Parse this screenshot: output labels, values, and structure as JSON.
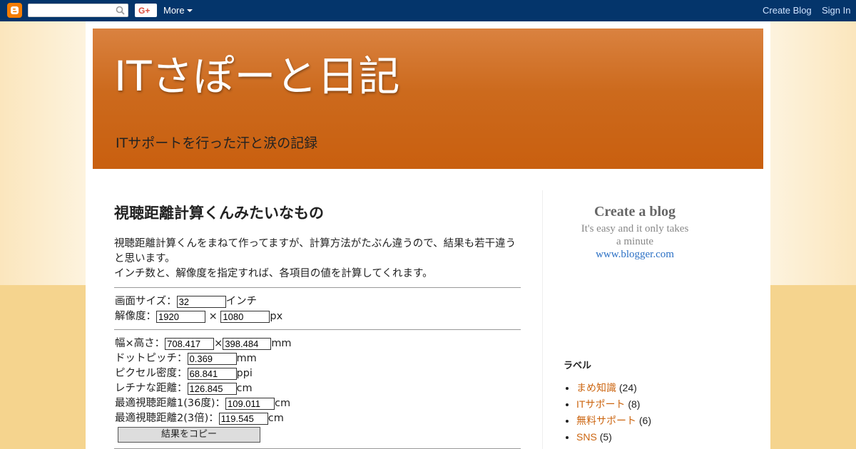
{
  "navbar": {
    "more_label": "More",
    "create_blog": "Create Blog",
    "sign_in": "Sign In",
    "gplus_label": "G+",
    "logo_icon": "blogger-logo-icon",
    "search_icon": "search-icon"
  },
  "header": {
    "title": "ITさぽーと日記",
    "description": "ITサポートを行った汗と涙の記録"
  },
  "post": {
    "title": "視聴距離計算くんみたいなもの",
    "intro_line1": "視聴距離計算くんをまねて作ってますが、計算方法がたぶん違うので、結果も若干違うと思います。",
    "intro_line2": "インチ数と、解像度を指定すれば、各項目の値を計算してくれます。"
  },
  "calculator": {
    "screen_size_label": "画面サイズ：",
    "screen_size_value": "32",
    "screen_size_unit": "インチ",
    "resolution_label": "解像度：",
    "resolution_w": "1920",
    "resolution_sep": " × ",
    "resolution_h": "1080",
    "resolution_unit": "px",
    "wh_label": "幅×高さ：",
    "wh_w": "708.417",
    "wh_sep": "×",
    "wh_h": "398.484",
    "wh_unit": "mm",
    "dot_pitch_label": "ドットピッチ：",
    "dot_pitch_value": "0.369",
    "dot_pitch_unit": "mm",
    "ppi_label": "ピクセル密度：",
    "ppi_value": "68.841",
    "ppi_unit": "ppi",
    "retina_label": "レチナな距離：",
    "retina_value": "126.845",
    "retina_unit": "cm",
    "optimal1_label": "最適視聴距離1(36度)：",
    "optimal1_value": "109.011",
    "optimal1_unit": "cm",
    "optimal2_label": "最適視聴距離2(3倍)：",
    "optimal2_value": "119.545",
    "optimal2_unit": "cm",
    "copy_button": "結果をコピー"
  },
  "sidebar": {
    "create_blog_title": "Create a blog",
    "create_blog_text1": "It's easy and it only takes",
    "create_blog_text2": "a minute",
    "create_blog_link": "www.blogger.com",
    "labels_title": "ラベル",
    "labels": [
      {
        "name": "まめ知識",
        "count": "(24)"
      },
      {
        "name": "ITサポート",
        "count": "(8)"
      },
      {
        "name": "無料サポート",
        "count": "(6)"
      },
      {
        "name": "SNS",
        "count": "(5)"
      }
    ]
  }
}
